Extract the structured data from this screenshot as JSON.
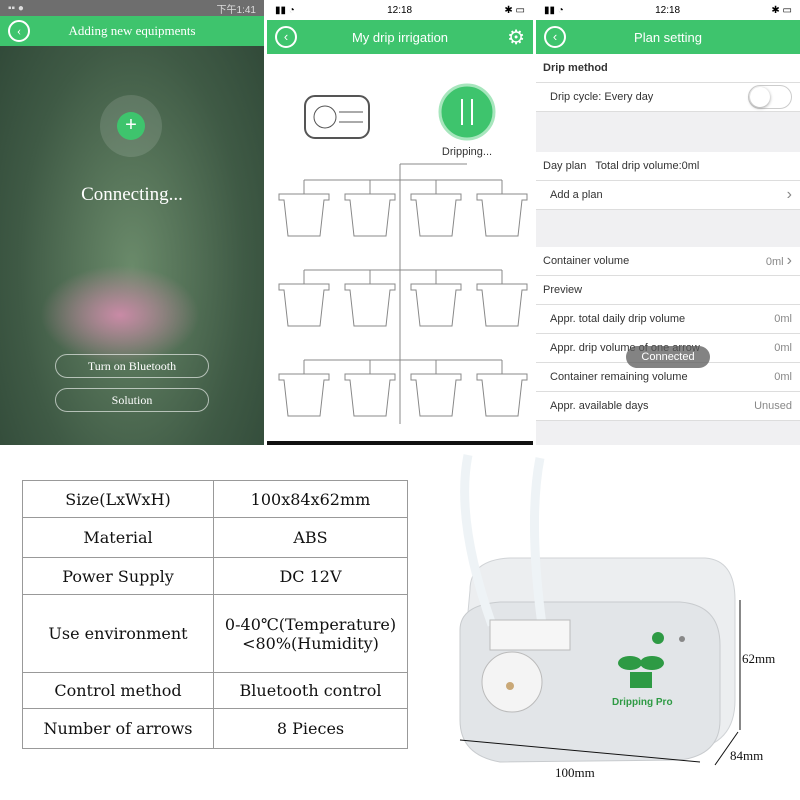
{
  "screen1": {
    "status_time": "下午1:41",
    "title": "Adding new equipments",
    "status": "Connecting...",
    "buttons": [
      "Turn on Bluetooth",
      "Solution"
    ]
  },
  "screen2": {
    "status_time": "12:18",
    "title": "My drip irrigation",
    "state": "Dripping..."
  },
  "screen3": {
    "status_time": "12:18",
    "title": "Plan setting",
    "drip_method": "Drip method",
    "drip_cycle": "Drip cycle: Every day",
    "drip_cycle_on": false,
    "day_plan": "Day plan",
    "total_volume": "Total drip volume:0ml",
    "add_plan": "Add a plan",
    "container_volume": "Container volume",
    "container_value": "0ml",
    "preview": "Preview",
    "preview_rows": [
      {
        "label": "Appr. total daily drip volume",
        "value": "0ml"
      },
      {
        "label": "Appr. drip volume of one arrow",
        "value": "0ml"
      },
      {
        "label": "Container remaining volume",
        "value": "0ml"
      },
      {
        "label": "Appr. available days",
        "value": "Unused"
      }
    ],
    "toast": "Connected"
  },
  "specs": [
    {
      "k": "Size(LxWxH)",
      "v": "100x84x62mm"
    },
    {
      "k": "Material",
      "v": "ABS"
    },
    {
      "k": "Power Supply",
      "v": "DC 12V"
    },
    {
      "k": "Use environment",
      "v": "0-40℃(Temperature)",
      "v2": "<80%(Humidity)"
    },
    {
      "k": "Control method",
      "v": "Bluetooth control"
    },
    {
      "k": "Number of arrows",
      "v": "8 Pieces"
    }
  ],
  "device": {
    "brand": "Dripping Pro",
    "height": "62mm",
    "depth": "84mm",
    "width": "100mm",
    "accent": "#2e9a44"
  },
  "colors": {
    "header": "#3ec46d"
  }
}
